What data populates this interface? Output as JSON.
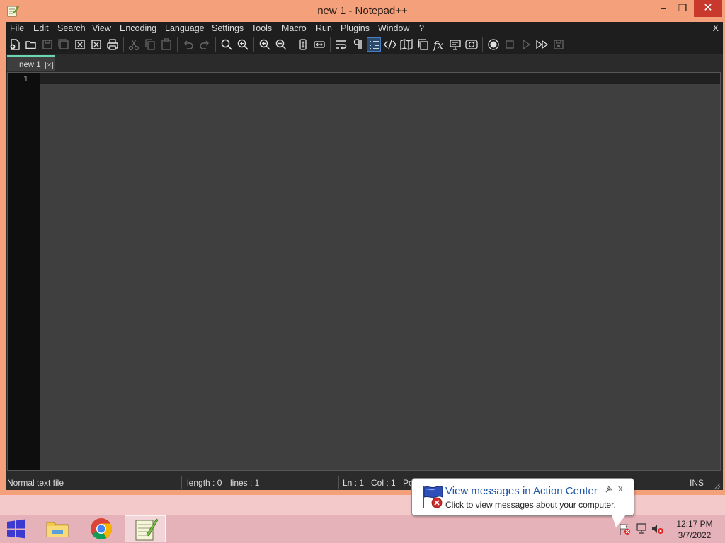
{
  "window": {
    "title": "new 1 - Notepad++",
    "min_label": "‒",
    "max_label": "❐",
    "close_label": "✕"
  },
  "menu": {
    "items": [
      "File",
      "Edit",
      "Search",
      "View",
      "Encoding",
      "Language",
      "Settings",
      "Tools",
      "Macro",
      "Run",
      "Plugins",
      "Window",
      "?"
    ],
    "close_label": "X"
  },
  "toolbar": {
    "icons": [
      "new-file-icon",
      "open-file-icon",
      "save-icon",
      "save-all-icon",
      "close-icon",
      "close-all-icon",
      "print-icon",
      "cut-icon",
      "copy-icon",
      "paste-icon",
      "undo-icon",
      "redo-icon",
      "find-icon",
      "replace-icon",
      "zoom-in-icon",
      "zoom-out-icon",
      "sync-vertical-icon",
      "sync-horizontal-icon",
      "word-wrap-icon",
      "show-all-characters-icon",
      "indent-guide-icon",
      "xml-tag-icon",
      "document-map-icon",
      "document-list-icon",
      "function-list-icon",
      "folder-as-workspace-icon",
      "monitoring-icon",
      "record-macro-icon",
      "stop-recording-icon",
      "play-macro-icon",
      "run-macro-multiple-icon",
      "save-macro-icon"
    ]
  },
  "tabs": [
    {
      "label": "new 1",
      "close": "✕"
    }
  ],
  "editor": {
    "line_numbers": [
      "1"
    ]
  },
  "status": {
    "file_type": "Normal text file",
    "length": "length : 0",
    "lines": "lines : 1",
    "ln": "Ln : 1",
    "col": "Col : 1",
    "pos": "Pc",
    "mode": "INS"
  },
  "popup": {
    "title": "View messages in Action Center",
    "body": "Click to view messages about your computer.",
    "close": "x"
  },
  "taskbar": {
    "apps": [
      "file-explorer-icon",
      "chrome-icon",
      "notepad-plus-plus-icon"
    ],
    "time": "12:17 PM",
    "date": "3/7/2022"
  },
  "colors": {
    "frame": "#f3a07b",
    "editor_bg": "#3f3f3f",
    "gutter_bg": "#0e0e0e",
    "tab_accent": "#6ad6b4",
    "close_red": "#c8382d",
    "popup_title": "#1f56a8",
    "taskbar": "#e6b2b9"
  }
}
